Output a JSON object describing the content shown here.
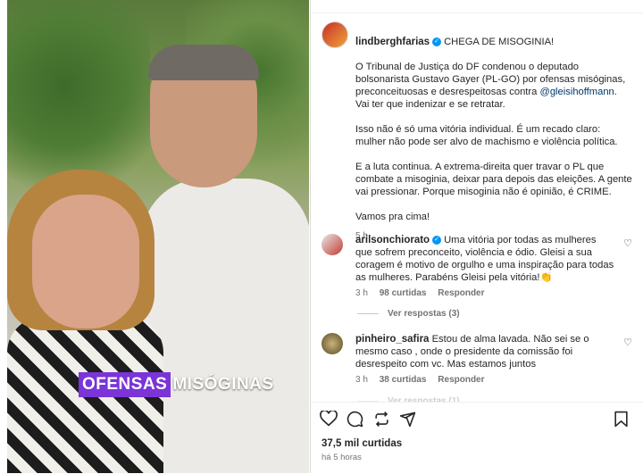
{
  "video": {
    "caption_highlight": "OFENSAS",
    "caption_rest": "MISÓGINAS"
  },
  "post": {
    "username": "lindberghfarias",
    "headline": "CHEGA DE MISOGINIA!",
    "para1_a": "O Tribunal de Justiça do DF condenou o deputado bolsonarista Gustavo Gayer (PL-GO) por ofensas misóginas, preconceituosas e desrespeitosas contra ",
    "para1_mention": "@gleisihoffmann",
    "para1_b": ". Vai ter que indenizar e se retratar.",
    "para2": "Isso não é só uma vitória individual. É um recado claro: mulher não pode ser alvo de machismo e violência política.",
    "para3": "E a luta continua. A extrema-direita quer travar o PL que combate a misoginia, deixar para depois das eleições. A gente vai pressionar. Porque misoginia não é opinião, é CRIME.",
    "para4": "Vamos pra cima!",
    "age": "5 h"
  },
  "comments": [
    {
      "username": "arilsonchiorato",
      "text": "Uma vitória por todas as mulheres que sofrem preconceito, violência e ódio. Gleisi a sua coragem é motivo de orgulho e uma inspiração para todas as mulheres. Parabéns Gleisi pela vitória!👏",
      "age": "3 h",
      "likes": "98 curtidas",
      "reply": "Responder",
      "view_replies": "Ver respostas (3)"
    },
    {
      "username": "pinheiro_safira",
      "text": "Estou de alma lavada. Não sei se o mesmo caso , onde o presidente da comissão foi desrespeito com vc. Mas estamos juntos",
      "age": "3 h",
      "likes": "38 curtidas",
      "reply": "Responder",
      "view_replies": "Ver respostas (1)"
    }
  ],
  "footer": {
    "likes": "37,5 mil curtidas",
    "time": "há 5 horas"
  },
  "icons": {
    "like": "heart-icon",
    "comment": "comment-icon",
    "share": "repost-icon",
    "send": "send-icon",
    "save": "bookmark-icon"
  },
  "colors": {
    "caption_highlight": "#7a34d8",
    "link": "#00376b",
    "verified": "#0095f6"
  }
}
